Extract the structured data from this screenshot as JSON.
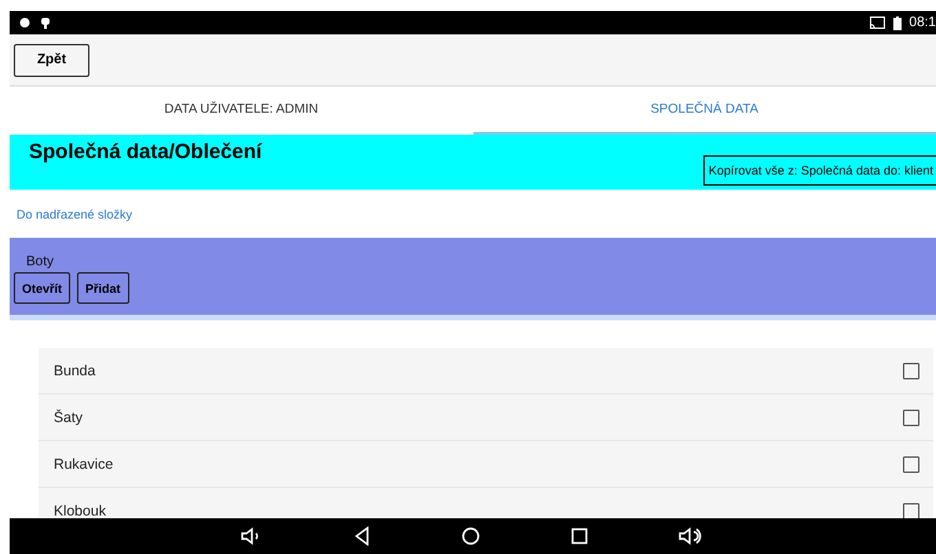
{
  "status_bar": {
    "time": "08:1"
  },
  "toolbar": {
    "back_button": "Zpět"
  },
  "tabs": [
    {
      "label": "DATA UŽIVATELE: ADMIN",
      "selected": false
    },
    {
      "label": "SPOLEČNÁ DATA",
      "selected": true
    }
  ],
  "header": {
    "title": "Společná data/Oblečení",
    "copy_button": "Kopírovat vše z: Společná data do: klient"
  },
  "parent_link": "Do nadřazené složky",
  "folder": {
    "name": "Boty",
    "buttons": [
      "Otevřít",
      "Přidat"
    ]
  },
  "items": [
    {
      "label": "Bunda",
      "checked": false
    },
    {
      "label": "Šaty",
      "checked": false
    },
    {
      "label": "Rukavice",
      "checked": false
    },
    {
      "label": "Klobouk",
      "checked": false
    }
  ]
}
